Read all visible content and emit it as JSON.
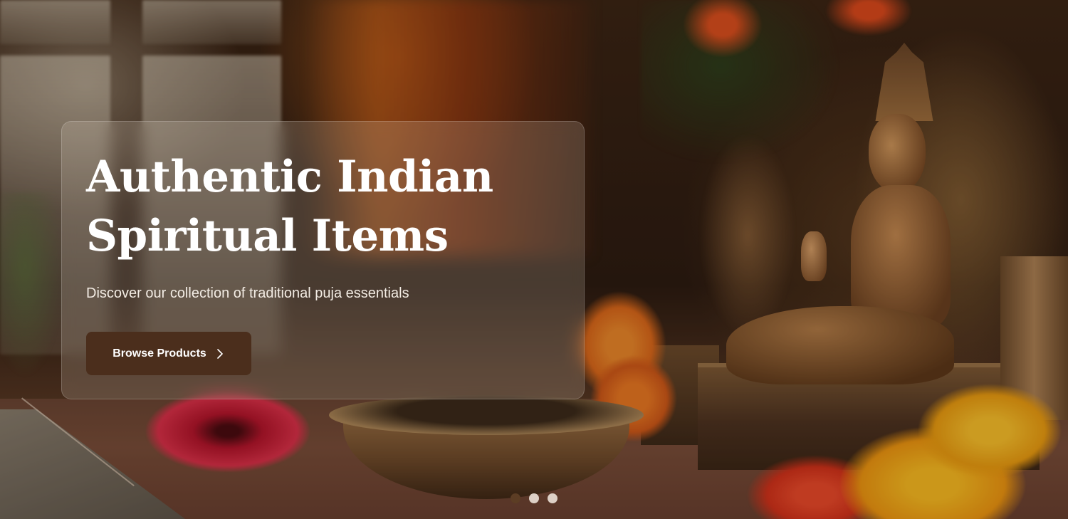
{
  "hero": {
    "title": "Authentic Indian\nSpiritual Items",
    "subtitle": "Discover our collection of traditional puja essentials",
    "cta_label": "Browse Products",
    "cta_icon": "chevron-right-icon",
    "background_image": "hero-image"
  },
  "carousel": {
    "slide_count": 3,
    "active_index": 0
  },
  "colors": {
    "button_bg": "#4b2e1c",
    "active_dot": "#5c3d24",
    "inactive_dot": "#ebe1d7",
    "title_text": "#ffffff"
  }
}
